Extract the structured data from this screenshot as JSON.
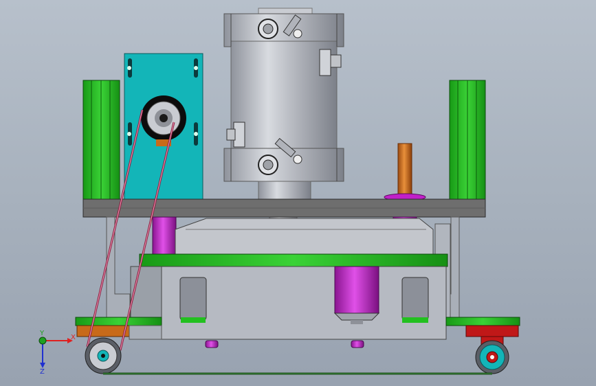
{
  "viewport": {
    "background_top": "#b7c0cb",
    "background_bottom": "#98a2b0"
  },
  "triad": {
    "x_label": "X",
    "y_label": "Y",
    "z_label": "Z",
    "x_color": "#e02020",
    "y_color": "#20a020",
    "z_color": "#2030d0"
  },
  "colors": {
    "green": "#22c01f",
    "teal": "#13b5b8",
    "magenta": "#c020c8",
    "gray_plate": "#6e6e6e",
    "silver": "#b9bcc4",
    "copper": "#c86a1a",
    "red_caster": "#c01818",
    "belt": "#8a1a3a"
  }
}
